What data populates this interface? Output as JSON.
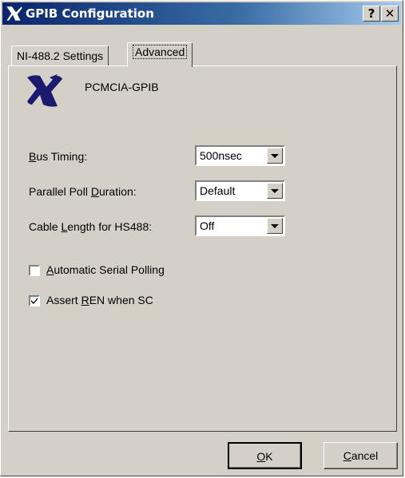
{
  "window": {
    "title": "GPIB Configuration",
    "help_label": "?",
    "close_label": "✕"
  },
  "tabs": [
    {
      "label": "NI-488.2 Settings",
      "active": false
    },
    {
      "label": "Advanced",
      "active": true
    }
  ],
  "device": {
    "name": "PCMCIA-GPIB"
  },
  "fields": {
    "bus_timing": {
      "label_pre": "",
      "label_u": "B",
      "label_post": "us Timing:",
      "value": "500nsec"
    },
    "parallel_poll": {
      "label_pre": "Parallel Poll ",
      "label_u": "D",
      "label_post": "uration:",
      "value": "Default"
    },
    "cable_length": {
      "label_pre": "Cable ",
      "label_u": "L",
      "label_post": "ength for HS488:",
      "value": "Off"
    }
  },
  "checkboxes": {
    "auto_serial": {
      "label_pre": "",
      "label_u": "A",
      "label_post": "utomatic Serial Polling",
      "checked": false
    },
    "assert_ren": {
      "label_pre": "Assert ",
      "label_u": "R",
      "label_post": "EN when SC",
      "checked": true
    }
  },
  "buttons": {
    "ok": {
      "label_u": "O",
      "label_post": "K"
    },
    "cancel": {
      "label_u": "C",
      "label_post": "ancel"
    }
  },
  "colors": {
    "title_start": "#0a246a",
    "title_end": "#a6caf0",
    "face": "#d4d0c8",
    "logo": "#1a1a6e"
  }
}
